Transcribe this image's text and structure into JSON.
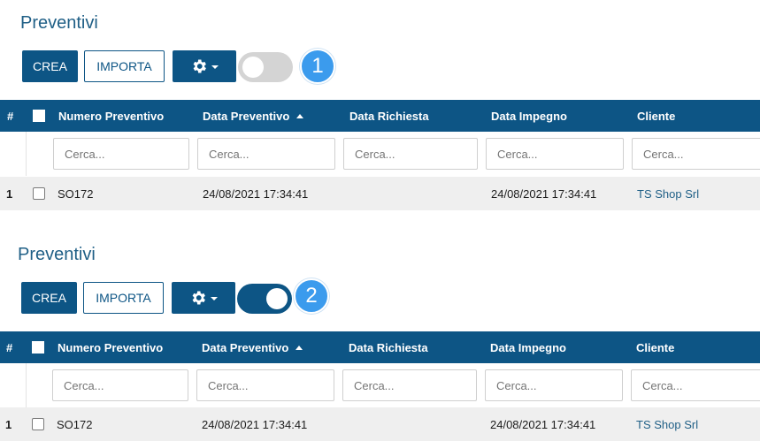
{
  "colors": {
    "primary": "#0d5585",
    "badge": "#3b9bed",
    "toggle_off": "#d4d4d4",
    "row_bg": "#efefef"
  },
  "panels": [
    {
      "title": "Preventivi",
      "toolbar": {
        "create_label": "CREA",
        "import_label": "IMPORTA",
        "settings_icon": "gear-icon",
        "toggle_state": "off"
      },
      "badge": "1",
      "columns": {
        "index": "#",
        "numero": "Numero Preventivo",
        "data_preventivo": "Data Preventivo",
        "data_richiesta": "Data Richiesta",
        "data_impegno": "Data Impegno",
        "cliente": "Cliente"
      },
      "sort": {
        "column": "Data Preventivo",
        "direction": "ascending"
      },
      "filter_placeholder": "Cerca...",
      "rows": [
        {
          "index": "1",
          "numero": "SO172",
          "data_preventivo": "24/08/2021 17:34:41",
          "data_richiesta": "",
          "data_impegno": "24/08/2021 17:34:41",
          "cliente": "TS Shop Srl"
        }
      ]
    },
    {
      "title": "Preventivi",
      "toolbar": {
        "create_label": "CREA",
        "import_label": "IMPORTA",
        "settings_icon": "gear-icon",
        "toggle_state": "on"
      },
      "badge": "2",
      "columns": {
        "index": "#",
        "numero": "Numero Preventivo",
        "data_preventivo": "Data Preventivo",
        "data_richiesta": "Data Richiesta",
        "data_impegno": "Data Impegno",
        "cliente": "Cliente"
      },
      "sort": {
        "column": "Data Preventivo",
        "direction": "ascending"
      },
      "filter_placeholder": "Cerca...",
      "rows": [
        {
          "index": "1",
          "numero": "SO172",
          "data_preventivo": "24/08/2021 17:34:41",
          "data_richiesta": "",
          "data_impegno": "24/08/2021 17:34:41",
          "cliente": "TS Shop Srl"
        }
      ]
    }
  ]
}
